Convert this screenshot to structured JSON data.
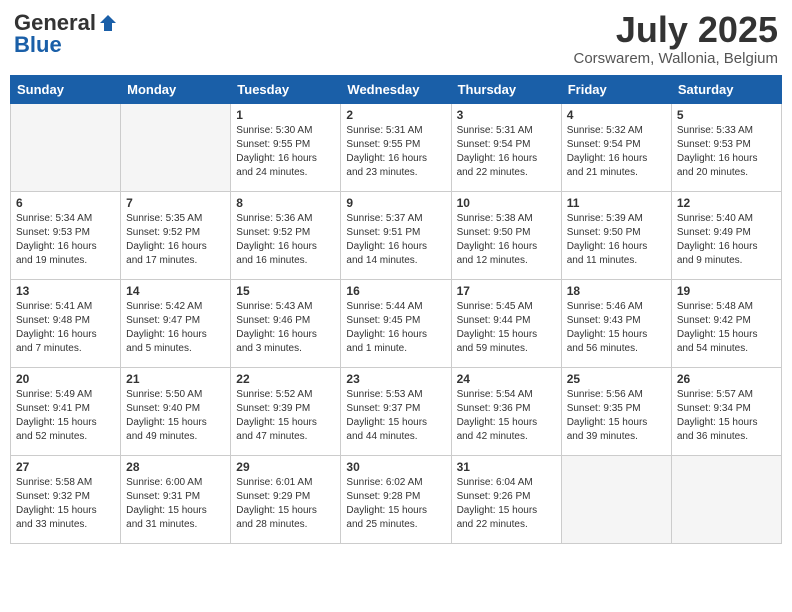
{
  "logo": {
    "general": "General",
    "blue": "Blue"
  },
  "title": "July 2025",
  "location": "Corswarem, Wallonia, Belgium",
  "weekdays": [
    "Sunday",
    "Monday",
    "Tuesday",
    "Wednesday",
    "Thursday",
    "Friday",
    "Saturday"
  ],
  "weeks": [
    [
      {
        "day": "",
        "info": ""
      },
      {
        "day": "",
        "info": ""
      },
      {
        "day": "1",
        "info": "Sunrise: 5:30 AM\nSunset: 9:55 PM\nDaylight: 16 hours and 24 minutes."
      },
      {
        "day": "2",
        "info": "Sunrise: 5:31 AM\nSunset: 9:55 PM\nDaylight: 16 hours and 23 minutes."
      },
      {
        "day": "3",
        "info": "Sunrise: 5:31 AM\nSunset: 9:54 PM\nDaylight: 16 hours and 22 minutes."
      },
      {
        "day": "4",
        "info": "Sunrise: 5:32 AM\nSunset: 9:54 PM\nDaylight: 16 hours and 21 minutes."
      },
      {
        "day": "5",
        "info": "Sunrise: 5:33 AM\nSunset: 9:53 PM\nDaylight: 16 hours and 20 minutes."
      }
    ],
    [
      {
        "day": "6",
        "info": "Sunrise: 5:34 AM\nSunset: 9:53 PM\nDaylight: 16 hours and 19 minutes."
      },
      {
        "day": "7",
        "info": "Sunrise: 5:35 AM\nSunset: 9:52 PM\nDaylight: 16 hours and 17 minutes."
      },
      {
        "day": "8",
        "info": "Sunrise: 5:36 AM\nSunset: 9:52 PM\nDaylight: 16 hours and 16 minutes."
      },
      {
        "day": "9",
        "info": "Sunrise: 5:37 AM\nSunset: 9:51 PM\nDaylight: 16 hours and 14 minutes."
      },
      {
        "day": "10",
        "info": "Sunrise: 5:38 AM\nSunset: 9:50 PM\nDaylight: 16 hours and 12 minutes."
      },
      {
        "day": "11",
        "info": "Sunrise: 5:39 AM\nSunset: 9:50 PM\nDaylight: 16 hours and 11 minutes."
      },
      {
        "day": "12",
        "info": "Sunrise: 5:40 AM\nSunset: 9:49 PM\nDaylight: 16 hours and 9 minutes."
      }
    ],
    [
      {
        "day": "13",
        "info": "Sunrise: 5:41 AM\nSunset: 9:48 PM\nDaylight: 16 hours and 7 minutes."
      },
      {
        "day": "14",
        "info": "Sunrise: 5:42 AM\nSunset: 9:47 PM\nDaylight: 16 hours and 5 minutes."
      },
      {
        "day": "15",
        "info": "Sunrise: 5:43 AM\nSunset: 9:46 PM\nDaylight: 16 hours and 3 minutes."
      },
      {
        "day": "16",
        "info": "Sunrise: 5:44 AM\nSunset: 9:45 PM\nDaylight: 16 hours and 1 minute."
      },
      {
        "day": "17",
        "info": "Sunrise: 5:45 AM\nSunset: 9:44 PM\nDaylight: 15 hours and 59 minutes."
      },
      {
        "day": "18",
        "info": "Sunrise: 5:46 AM\nSunset: 9:43 PM\nDaylight: 15 hours and 56 minutes."
      },
      {
        "day": "19",
        "info": "Sunrise: 5:48 AM\nSunset: 9:42 PM\nDaylight: 15 hours and 54 minutes."
      }
    ],
    [
      {
        "day": "20",
        "info": "Sunrise: 5:49 AM\nSunset: 9:41 PM\nDaylight: 15 hours and 52 minutes."
      },
      {
        "day": "21",
        "info": "Sunrise: 5:50 AM\nSunset: 9:40 PM\nDaylight: 15 hours and 49 minutes."
      },
      {
        "day": "22",
        "info": "Sunrise: 5:52 AM\nSunset: 9:39 PM\nDaylight: 15 hours and 47 minutes."
      },
      {
        "day": "23",
        "info": "Sunrise: 5:53 AM\nSunset: 9:37 PM\nDaylight: 15 hours and 44 minutes."
      },
      {
        "day": "24",
        "info": "Sunrise: 5:54 AM\nSunset: 9:36 PM\nDaylight: 15 hours and 42 minutes."
      },
      {
        "day": "25",
        "info": "Sunrise: 5:56 AM\nSunset: 9:35 PM\nDaylight: 15 hours and 39 minutes."
      },
      {
        "day": "26",
        "info": "Sunrise: 5:57 AM\nSunset: 9:34 PM\nDaylight: 15 hours and 36 minutes."
      }
    ],
    [
      {
        "day": "27",
        "info": "Sunrise: 5:58 AM\nSunset: 9:32 PM\nDaylight: 15 hours and 33 minutes."
      },
      {
        "day": "28",
        "info": "Sunrise: 6:00 AM\nSunset: 9:31 PM\nDaylight: 15 hours and 31 minutes."
      },
      {
        "day": "29",
        "info": "Sunrise: 6:01 AM\nSunset: 9:29 PM\nDaylight: 15 hours and 28 minutes."
      },
      {
        "day": "30",
        "info": "Sunrise: 6:02 AM\nSunset: 9:28 PM\nDaylight: 15 hours and 25 minutes."
      },
      {
        "day": "31",
        "info": "Sunrise: 6:04 AM\nSunset: 9:26 PM\nDaylight: 15 hours and 22 minutes."
      },
      {
        "day": "",
        "info": ""
      },
      {
        "day": "",
        "info": ""
      }
    ]
  ]
}
